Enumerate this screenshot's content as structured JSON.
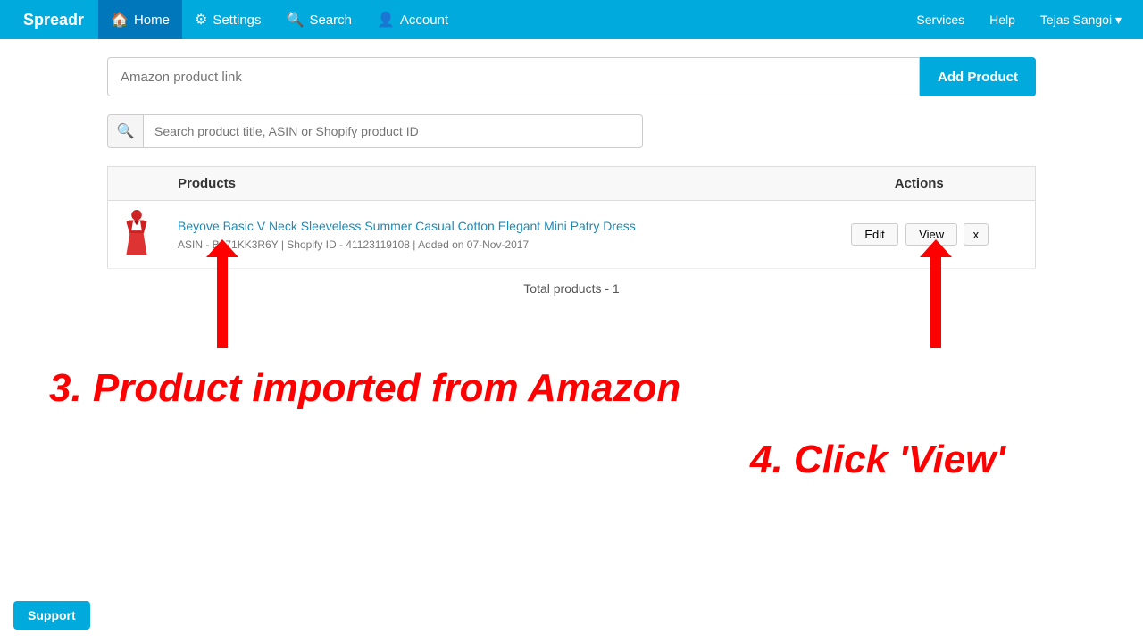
{
  "navbar": {
    "brand": "Spreadr",
    "items": [
      {
        "label": "Home",
        "icon": "🏠",
        "active": true
      },
      {
        "label": "Settings",
        "icon": "⚙"
      },
      {
        "label": "Search",
        "icon": "🔍"
      },
      {
        "label": "Account",
        "icon": "👤"
      }
    ],
    "right_items": [
      {
        "label": "Services"
      },
      {
        "label": "Help"
      },
      {
        "label": "Tejas Sangoi ▾"
      }
    ]
  },
  "product_link_input": {
    "placeholder": "Amazon product link",
    "add_button_label": "Add Product"
  },
  "search_input": {
    "placeholder": "Search product title, ASIN or Shopify product ID"
  },
  "table": {
    "columns": [
      "Products",
      "Actions"
    ],
    "rows": [
      {
        "name": "Beyove Basic V Neck Sleeveless Summer Casual Cotton Elegant Mini Patry Dress",
        "asin": "B071KK3R6Y",
        "shopify_id": "41123119108",
        "added_on": "07-Nov-2017",
        "meta": "ASIN - B071KK3R6Y  |  Shopify ID - 41123119108  |  Added on 07-Nov-2017",
        "actions": [
          "Edit",
          "View",
          "x"
        ]
      }
    ]
  },
  "total_products_label": "Total products - 1",
  "annotations": {
    "step3": "3. Product imported from Amazon",
    "step4": "4. Click 'View'"
  },
  "support_label": "Support"
}
